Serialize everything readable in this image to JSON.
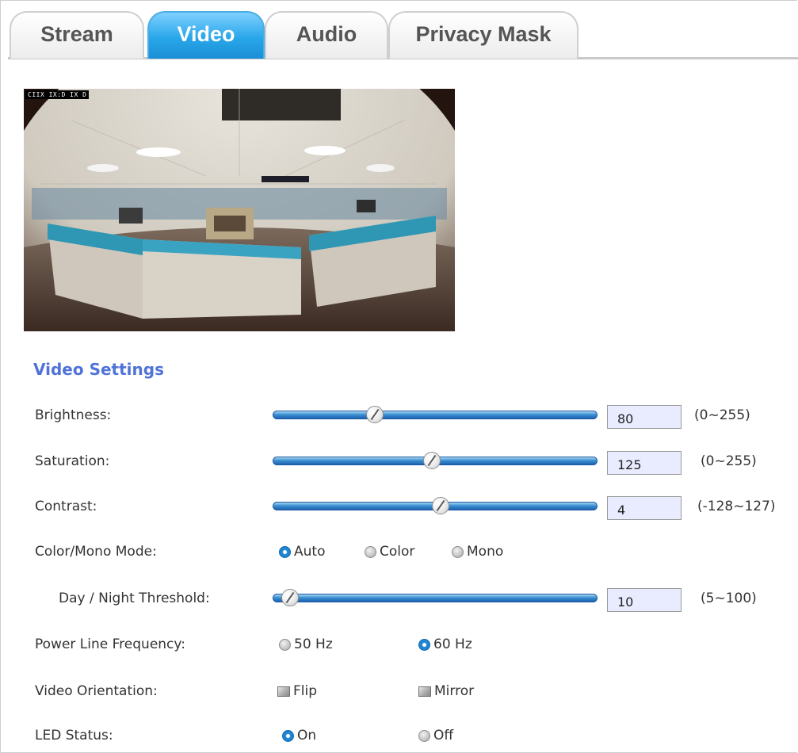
{
  "tabs": [
    {
      "label": "Stream",
      "active": false
    },
    {
      "label": "Video",
      "active": true
    },
    {
      "label": "Audio",
      "active": false
    },
    {
      "label": "Privacy Mask",
      "active": false
    }
  ],
  "preview": {
    "overlay_text": "CIIX IX:D IX D"
  },
  "settings": {
    "title": "Video Settings",
    "brightness": {
      "label": "Brightness:",
      "value": "80",
      "range": "(0~255)",
      "level": 0.314
    },
    "saturation": {
      "label": "Saturation:",
      "value": "125",
      "range": "(0~255)",
      "level": 0.49
    },
    "contrast": {
      "label": "Contrast:",
      "value": "4",
      "range": "(-128~127)",
      "level": 0.516
    },
    "color_mode": {
      "label": "Color/Mono Mode:",
      "options": [
        {
          "label": "Auto",
          "selected": true
        },
        {
          "label": "Color",
          "selected": false
        },
        {
          "label": "Mono",
          "selected": false
        }
      ]
    },
    "threshold": {
      "label": "Day / Night Threshold:",
      "value": "10",
      "range": "(5~100)",
      "level": 0.053
    },
    "power_line": {
      "label": "Power Line Frequency:",
      "options": [
        {
          "label": "50 Hz",
          "selected": false
        },
        {
          "label": "60 Hz",
          "selected": true
        }
      ]
    },
    "orientation": {
      "label": "Video Orientation:",
      "options": [
        {
          "label": "Flip",
          "checked": false
        },
        {
          "label": "Mirror",
          "checked": false
        }
      ]
    },
    "led": {
      "label": "LED Status:",
      "options": [
        {
          "label": "On",
          "selected": true
        },
        {
          "label": "Off",
          "selected": false
        }
      ]
    }
  },
  "colors": {
    "accent": "#1e86d4",
    "section_title": "#4f73d7",
    "tab_active": "#29a7ea",
    "value_box": "#e9ecff"
  }
}
